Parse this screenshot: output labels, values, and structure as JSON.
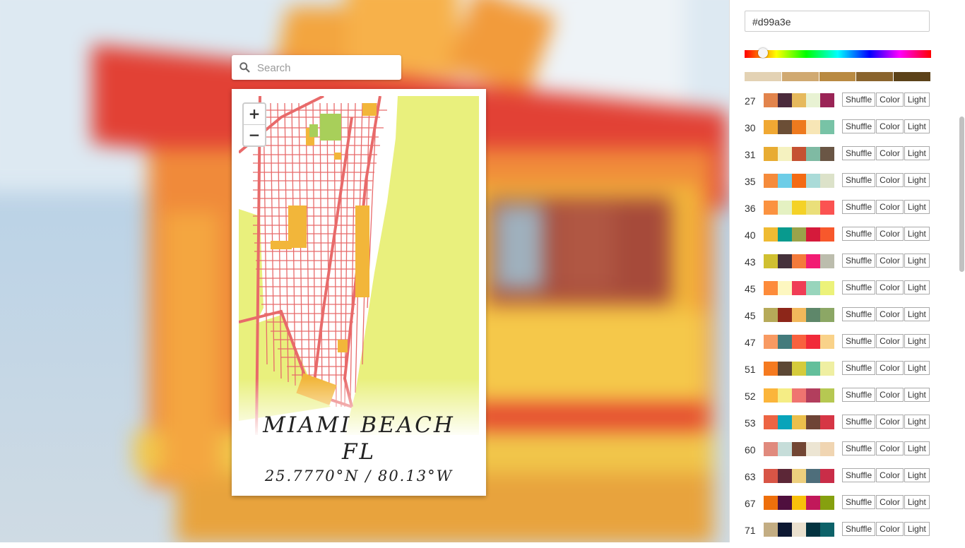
{
  "search": {
    "placeholder": "Search"
  },
  "map": {
    "zoom_in": "+",
    "zoom_out": "−"
  },
  "poster": {
    "city": "MIAMI BEACH",
    "region": "FL",
    "coords": "25.7770°N / 80.13°W"
  },
  "panel": {
    "hex_value": "#d99a3e",
    "shades": [
      "#e3d2b4",
      "#d0a971",
      "#b98a42",
      "#8a642d",
      "#5c4219"
    ],
    "button_labels": {
      "shuffle": "Shuffle",
      "color": "Color",
      "light": "Light"
    },
    "palettes": [
      {
        "id": "27",
        "colors": [
          "#e2844c",
          "#4b2b3c",
          "#e6b95c",
          "#e8f2d3",
          "#9a2456"
        ]
      },
      {
        "id": "30",
        "colors": [
          "#f0a833",
          "#6b4e36",
          "#ee7a1e",
          "#f7e6b6",
          "#78c3a6"
        ]
      },
      {
        "id": "31",
        "colors": [
          "#e8ac32",
          "#f5f2c0",
          "#c55132",
          "#7fbaa3",
          "#6a5645"
        ]
      },
      {
        "id": "35",
        "colors": [
          "#f58b3b",
          "#6dcde7",
          "#f46b14",
          "#aadbd8",
          "#dce2c9"
        ]
      },
      {
        "id": "36",
        "colors": [
          "#fb9240",
          "#e4f1c2",
          "#f4d227",
          "#eadf7a",
          "#fb5351"
        ]
      },
      {
        "id": "40",
        "colors": [
          "#efbb33",
          "#089a8e",
          "#9aa34a",
          "#d51a3b",
          "#f7582c"
        ]
      },
      {
        "id": "43",
        "colors": [
          "#d0c031",
          "#45313b",
          "#f47a3a",
          "#f21c73",
          "#bcbdad"
        ]
      },
      {
        "id": "45",
        "colors": [
          "#fd8b3a",
          "#fdf7c0",
          "#f03d55",
          "#98d5bc",
          "#ecf27a"
        ]
      },
      {
        "id": "45",
        "colors": [
          "#b6aa59",
          "#8d2619",
          "#f2b85b",
          "#5e876a",
          "#8ca765"
        ]
      },
      {
        "id": "47",
        "colors": [
          "#f89a62",
          "#437b7c",
          "#f9613e",
          "#f12a39",
          "#f9d289"
        ]
      },
      {
        "id": "51",
        "colors": [
          "#f57a20",
          "#5c4734",
          "#d5cb3b",
          "#63bf9b",
          "#efefa2"
        ]
      },
      {
        "id": "52",
        "colors": [
          "#fbb53b",
          "#f5ed85",
          "#ef7470",
          "#b23e5d",
          "#b6c852"
        ]
      },
      {
        "id": "53",
        "colors": [
          "#ed6443",
          "#08a4ba",
          "#ebbf4c",
          "#6e4436",
          "#d63645"
        ]
      },
      {
        "id": "60",
        "colors": [
          "#e08a7d",
          "#c6ddd9",
          "#724634",
          "#ece5d3",
          "#f0d5b2"
        ]
      },
      {
        "id": "63",
        "colors": [
          "#d85546",
          "#5c2737",
          "#edcf7e",
          "#4e6e7b",
          "#c92d48"
        ]
      },
      {
        "id": "67",
        "colors": [
          "#ee6f0b",
          "#4f0f3e",
          "#f8c00b",
          "#c1185a",
          "#86a00f"
        ]
      },
      {
        "id": "71",
        "colors": [
          "#c3ad83",
          "#0d1832",
          "#eae0ce",
          "#033340",
          "#0d6269"
        ]
      }
    ]
  }
}
